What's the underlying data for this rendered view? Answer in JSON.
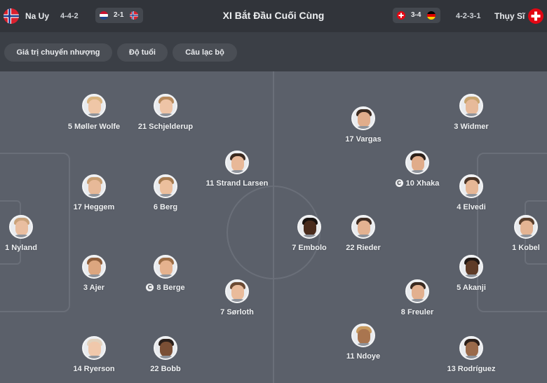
{
  "header": {
    "title": "XI Bắt Đầu Cuối Cùng",
    "home": {
      "name": "Na Uy",
      "formation": "4-4-2",
      "flag": "norway-flag"
    },
    "away": {
      "name": "Thụy Sĩ",
      "formation": "4-2-3-1",
      "flag": "switzerland-flag"
    },
    "home_form": {
      "score": "2-1",
      "flags": [
        "netherlands-flag",
        "norway-flag"
      ]
    },
    "away_form": {
      "score": "3-4",
      "flags": [
        "switzerland-flag",
        "germany-flag"
      ]
    }
  },
  "filters": [
    "Giá trị chuyển nhượng",
    "Độ tuổi",
    "Câu lạc bộ"
  ],
  "colors": {
    "background": "#3b3f46",
    "pitch": "#5b606a",
    "pitch_lines": "#6a6f79",
    "chip": "#4a4e55"
  },
  "home_players": [
    {
      "label": "1 Nyland",
      "captain": false
    },
    {
      "label": "5 Møller Wolfe",
      "captain": false
    },
    {
      "label": "21 Schjelderup",
      "captain": false
    },
    {
      "label": "17 Heggem",
      "captain": false
    },
    {
      "label": "6 Berg",
      "captain": false
    },
    {
      "label": "3 Ajer",
      "captain": false
    },
    {
      "label": "8 Berge",
      "captain": true
    },
    {
      "label": "14 Ryerson",
      "captain": false
    },
    {
      "label": "22 Bobb",
      "captain": false
    },
    {
      "label": "11 Strand Larsen",
      "captain": false
    },
    {
      "label": "7 Sørloth",
      "captain": false
    }
  ],
  "away_players": [
    {
      "label": "1 Kobel",
      "captain": false
    },
    {
      "label": "3 Widmer",
      "captain": false
    },
    {
      "label": "4 Elvedi",
      "captain": false
    },
    {
      "label": "5 Akanji",
      "captain": false
    },
    {
      "label": "13 Rodríguez",
      "captain": false
    },
    {
      "label": "10 Xhaka",
      "captain": true
    },
    {
      "label": "8 Freuler",
      "captain": false
    },
    {
      "label": "17 Vargas",
      "captain": false
    },
    {
      "label": "22 Rieder",
      "captain": false
    },
    {
      "label": "11 Ndoye",
      "captain": false
    },
    {
      "label": "7 Embolo",
      "captain": false
    }
  ]
}
